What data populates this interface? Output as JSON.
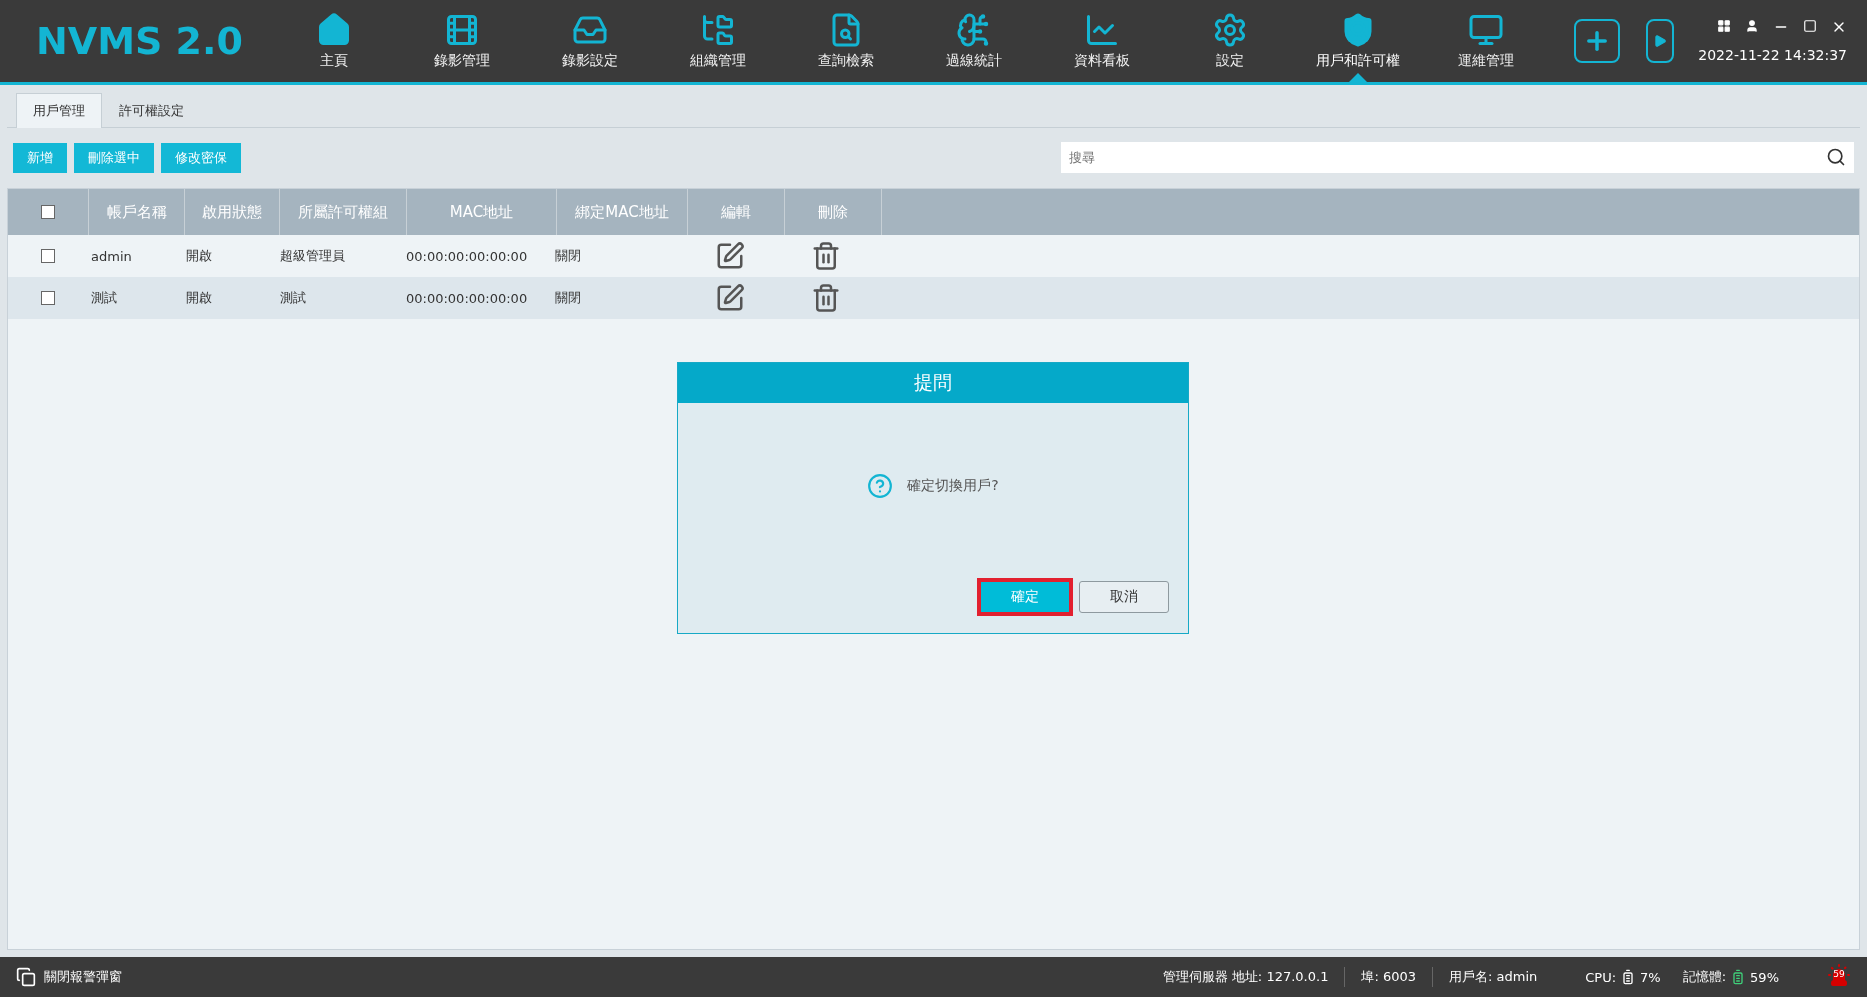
{
  "app": {
    "logo": "NVMS 2.0",
    "datetime": "2022-11-22 14:32:37"
  },
  "nav": [
    {
      "label": "主頁",
      "selected": false
    },
    {
      "label": "錄影管理",
      "selected": false
    },
    {
      "label": "錄影設定",
      "selected": false
    },
    {
      "label": "組織管理",
      "selected": false
    },
    {
      "label": "查詢檢索",
      "selected": false
    },
    {
      "label": "過線統計",
      "selected": false
    },
    {
      "label": "資料看板",
      "selected": false
    },
    {
      "label": "設定",
      "selected": false
    },
    {
      "label": "用戶和許可權",
      "selected": true
    },
    {
      "label": "運維管理",
      "selected": false
    }
  ],
  "tabs": [
    {
      "label": "用戶管理",
      "selected": true
    },
    {
      "label": "許可權設定",
      "selected": false
    }
  ],
  "toolbar": {
    "buttons": [
      "新增",
      "刪除選中",
      "修改密保"
    ],
    "search": {
      "placeholder": "搜尋"
    }
  },
  "table": {
    "select_all": {
      "checked": false
    },
    "columns": [
      "帳戶名稱",
      "啟用狀態",
      "所屬許可權組",
      "MAC地址",
      "綁定MAC地址",
      "編輯",
      "刪除"
    ],
    "rows": [
      {
        "checked": false,
        "cells": [
          "admin",
          "開啟",
          "超級管理員",
          "00:00:00:00:00:00",
          "關閉"
        ]
      },
      {
        "checked": false,
        "cells": [
          "測試",
          "開啟",
          "測試",
          "00:00:00:00:00:00",
          "關閉"
        ]
      }
    ]
  },
  "dialog": {
    "title": "提問",
    "message": "確定切換用戶?",
    "buttons": [
      {
        "label": "確定",
        "kind": "primary",
        "highlighted": true
      },
      {
        "label": "取消",
        "kind": "secondary",
        "highlighted": false
      }
    ]
  },
  "status_bar": {
    "alarm_toggle": "關閉報警彈窗",
    "server": "管理伺服器 地址: 127.0.0.1",
    "port": "埠: 6003",
    "user": "用戶名: admin",
    "cpu_label": "CPU:",
    "cpu_value": "7%",
    "memory_label": "記憶體:",
    "memory_value": "59%",
    "alarm_count": "59"
  }
}
